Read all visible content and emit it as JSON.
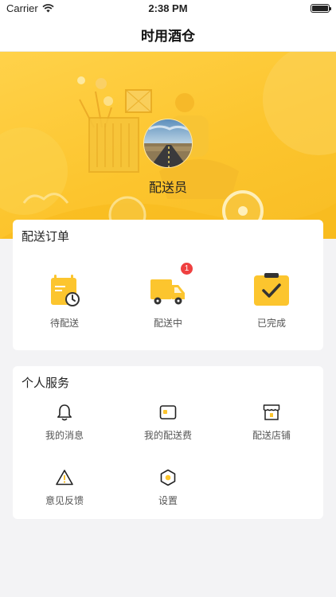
{
  "status_bar": {
    "carrier": "Carrier",
    "time": "2:38 PM",
    "battery_level": 1.0
  },
  "nav": {
    "title": "时用酒仓"
  },
  "profile": {
    "name": "配送员"
  },
  "orders": {
    "title": "配送订单",
    "items": [
      {
        "label": "待配送",
        "icon": "pending-delivery-icon"
      },
      {
        "label": "配送中",
        "icon": "delivery-truck-icon",
        "badge": "1"
      },
      {
        "label": "已完成",
        "icon": "completed-check-icon"
      }
    ]
  },
  "services": {
    "title": "个人服务",
    "items": [
      {
        "label": "我的消息",
        "icon": "bell-icon"
      },
      {
        "label": "我的配送费",
        "icon": "wallet-icon"
      },
      {
        "label": "配送店铺",
        "icon": "store-icon"
      },
      {
        "label": "意见反馈",
        "icon": "warning-icon"
      },
      {
        "label": "设置",
        "icon": "settings-icon"
      }
    ]
  },
  "colors": {
    "accent": "#fcc52e",
    "badge": "#ef4040",
    "background": "#f3f3f5"
  }
}
